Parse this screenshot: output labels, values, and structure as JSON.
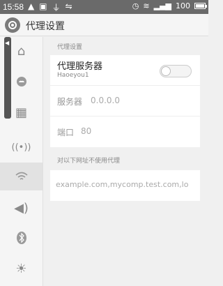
{
  "status_bar": {
    "time": "15:58",
    "battery": "100",
    "battery_level": 1.0,
    "left_icons": [
      "warning-icon",
      "image-icon",
      "usb-icon",
      "usb-debug-icon"
    ],
    "right_icons": [
      "alarm-icon",
      "wifi-icon",
      "signal-icon",
      "battery-icon"
    ]
  },
  "header": {
    "title": "代理设置",
    "icon": "settings-icon"
  },
  "side_nav": {
    "items": [
      {
        "icon": "home-icon"
      },
      {
        "icon": "cloud-icon"
      },
      {
        "icon": "grid-icon"
      },
      {
        "icon": "hotspot-icon"
      },
      {
        "icon": "wifi-icon",
        "active": true
      },
      {
        "icon": "sound-icon"
      },
      {
        "icon": "bluetooth-icon"
      },
      {
        "icon": "brightness-icon"
      }
    ]
  },
  "proxy": {
    "section_label": "代理设置",
    "server_title": "代理服务器",
    "network_name": "Haoeyou1",
    "toggle_on": false,
    "host_label": "服务器",
    "host_value": "0.0.0.0",
    "port_label": "端口",
    "port_value": "80"
  },
  "exclusion": {
    "label": "对以下网址不使用代理",
    "placeholder": "example.com,mycomp.test.com,lo"
  }
}
